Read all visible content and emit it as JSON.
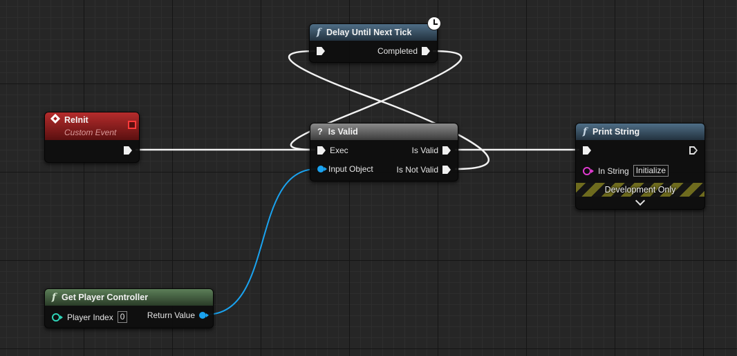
{
  "nodes": {
    "delay": {
      "title": "Delay Until Next Tick",
      "out_completed": "Completed",
      "icon": "function-icon",
      "badge": "clock-icon"
    },
    "reinit": {
      "title": "ReInit",
      "subtitle": "Custom Event",
      "icon": "event-icon",
      "color": "#a62020"
    },
    "is_valid": {
      "title": "Is Valid",
      "icon": "question-icon",
      "in_exec": "Exec",
      "in_object": "Input Object",
      "out_valid": "Is Valid",
      "out_not_valid": "Is Not Valid"
    },
    "print_string": {
      "title": "Print String",
      "icon": "function-icon",
      "in_string_label": "In String",
      "in_string_value": "Initialize",
      "dev_only": "Development Only",
      "expand_icon": "chevron-down-icon"
    },
    "get_player_controller": {
      "title": "Get Player Controller",
      "icon": "function-icon",
      "player_index_label": "Player Index",
      "player_index_value": "0",
      "return_value": "Return Value"
    }
  },
  "colors": {
    "exec_wire": "#f0f0f0",
    "object_wire": "#1aa3f0",
    "string_pin": "#e03ad0",
    "int_pin": "#2fd4b8",
    "function_header": "#3e5a70",
    "pure_header": "#4d6b49",
    "event_header": "#a62020"
  }
}
